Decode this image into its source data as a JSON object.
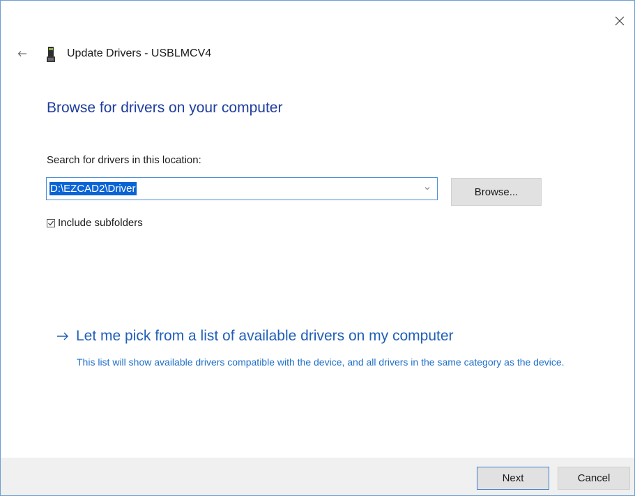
{
  "window": {
    "title": "Update Drivers - USBLMCV4",
    "close_icon": "close-icon",
    "back_icon": "back-arrow-icon",
    "device_icon": "usb-device-icon"
  },
  "main": {
    "heading": "Browse for drivers on your computer",
    "search_label": "Search for drivers in this location:",
    "path_value": "D:\\EZCAD2\\Driver",
    "browse_label": "Browse...",
    "include_subfolders_label": "Include subfolders",
    "include_subfolders_checked": true
  },
  "pick": {
    "label": "Let me pick from a list of available drivers on my computer",
    "description": "This list will show available drivers compatible with the device, and all drivers in the same category as the device."
  },
  "footer": {
    "next_label": "Next",
    "cancel_label": "Cancel"
  },
  "colors": {
    "heading": "#1e3d9e",
    "link": "#1f5fb8",
    "selection": "#0a64d6",
    "window_border": "#6d9fd1",
    "footer_bg": "#f0f0f0"
  }
}
